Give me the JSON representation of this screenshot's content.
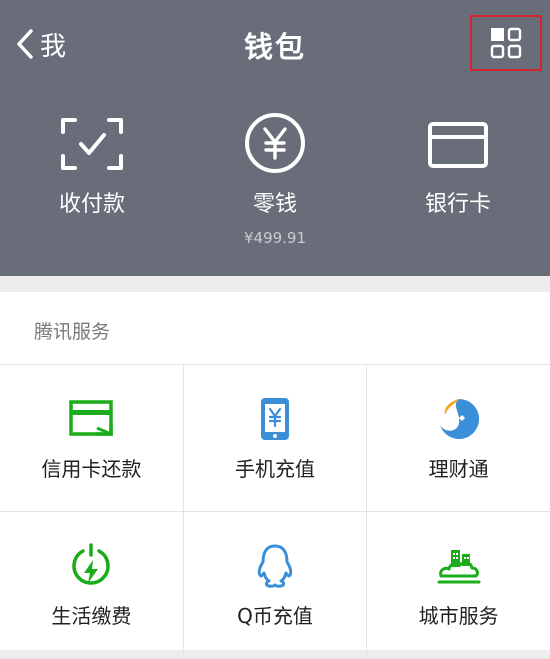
{
  "header": {
    "back_label": "我",
    "title": "钱包",
    "items": [
      {
        "label": "收付款",
        "icon": "scan-pay-icon"
      },
      {
        "label": "零钱",
        "sub": "¥499.91",
        "icon": "yuan-coin-icon"
      },
      {
        "label": "银行卡",
        "icon": "bank-card-icon"
      }
    ]
  },
  "section": {
    "title": "腾讯服务",
    "rows": [
      [
        {
          "label": "信用卡还款",
          "icon": "credit-card-repay-icon"
        },
        {
          "label": "手机充值",
          "icon": "mobile-topup-icon"
        },
        {
          "label": "理财通",
          "icon": "wealth-icon"
        }
      ],
      [
        {
          "label": "生活缴费",
          "icon": "utility-bill-icon"
        },
        {
          "label": "Q币充值",
          "icon": "qq-penguin-icon"
        },
        {
          "label": "城市服务",
          "icon": "city-services-icon"
        }
      ]
    ]
  },
  "colors": {
    "header_bg": "#686d79",
    "highlight_border": "#d4242e",
    "green": "#1aad19",
    "blue": "#3b8fd8"
  }
}
